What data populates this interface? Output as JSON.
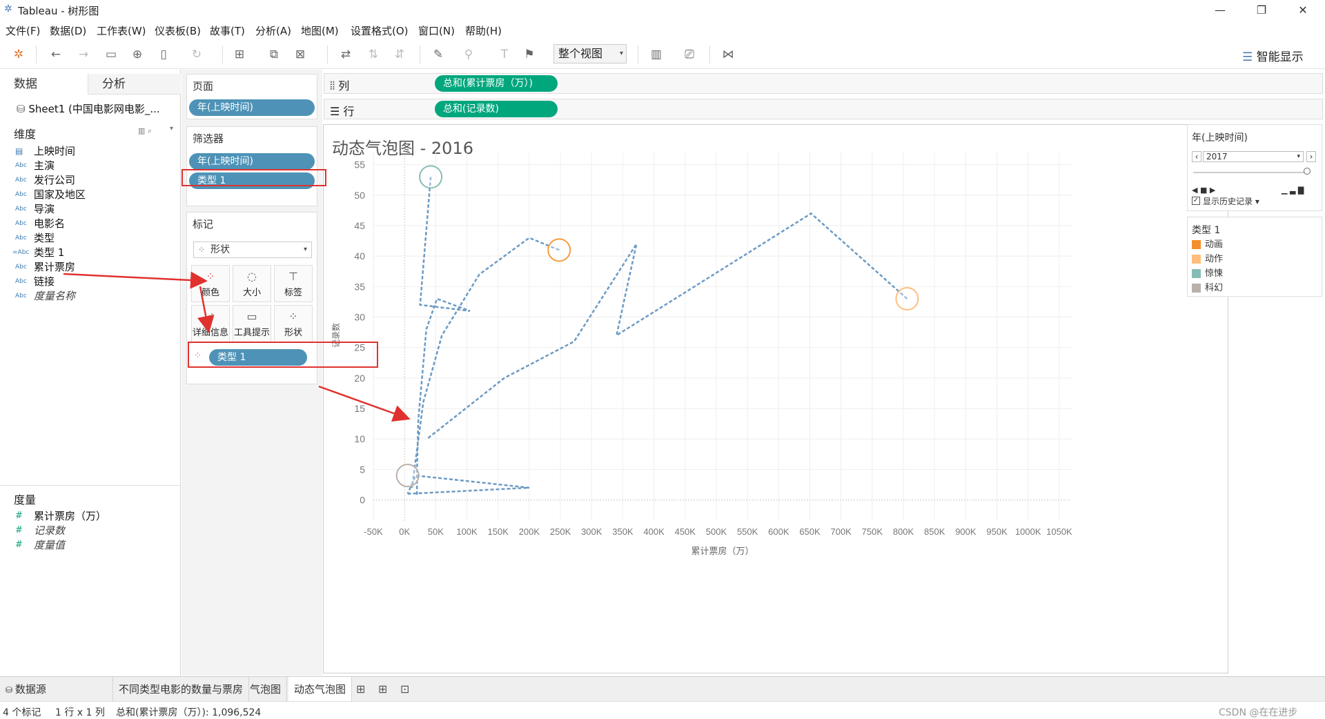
{
  "window": {
    "title": "Tableau - 树形图",
    "minimize": "—",
    "restore": "❐",
    "close": "✕"
  },
  "menu": [
    "文件(F)",
    "数据(D)",
    "工作表(W)",
    "仪表板(B)",
    "故事(T)",
    "分析(A)",
    "地图(M)",
    "设置格式(O)",
    "窗口(N)",
    "帮助(H)"
  ],
  "toolbar": {
    "view_mode": "整个视图",
    "smart_show": "智能显示"
  },
  "left": {
    "tab_data": "数据",
    "tab_analysis": "分析",
    "source": "Sheet1 (中国电影网电影_...",
    "dimensions_title": "维度",
    "dimensions": [
      {
        "icon": "date",
        "name": "上映时间"
      },
      {
        "icon": "Abc",
        "name": "主演"
      },
      {
        "icon": "Abc",
        "name": "发行公司"
      },
      {
        "icon": "Abc",
        "name": "国家及地区"
      },
      {
        "icon": "Abc",
        "name": "导演"
      },
      {
        "icon": "Abc",
        "name": "电影名"
      },
      {
        "icon": "Abc",
        "name": "类型"
      },
      {
        "icon": "=Abc",
        "name": "类型 1"
      },
      {
        "icon": "Abc",
        "name": "累计票房"
      },
      {
        "icon": "Abc",
        "name": "链接"
      },
      {
        "icon": "Abc",
        "name": "度量名称"
      }
    ],
    "measures_title": "度量",
    "measures": [
      {
        "name": "累计票房（万）"
      },
      {
        "name": "记录数"
      },
      {
        "name": "度量值"
      }
    ]
  },
  "shelves": {
    "pages_title": "页面",
    "pages_pill": "年(上映时间)",
    "filters_title": "筛选器",
    "filter_pills": [
      "年(上映时间)",
      "类型 1"
    ],
    "marks_title": "标记",
    "mark_type": "形状",
    "mark_buttons": [
      "颜色",
      "大小",
      "标签",
      "详细信息",
      "工具提示",
      "形状"
    ],
    "mark_pill": "类型 1",
    "columns_label": "列",
    "columns_pill": "总和(累计票房（万）)",
    "rows_label": "行",
    "rows_pill": "总和(记录数)"
  },
  "chart_data": {
    "type": "scatter",
    "title": "动态气泡图 - 2016",
    "xlabel": "累计票房（万）",
    "ylabel": "记录数",
    "xlim": [
      -50000,
      1070000
    ],
    "ylim": [
      -3,
      57
    ],
    "x_ticks": [
      "-50K",
      "0K",
      "50K",
      "100K",
      "150K",
      "200K",
      "250K",
      "300K",
      "350K",
      "400K",
      "450K",
      "500K",
      "550K",
      "600K",
      "650K",
      "700K",
      "750K",
      "800K",
      "850K",
      "900K",
      "950K",
      "1000K",
      "1050K"
    ],
    "y_ticks": [
      "0",
      "5",
      "10",
      "15",
      "20",
      "25",
      "30",
      "35",
      "40",
      "45",
      "50",
      "55"
    ],
    "grid": true,
    "history_trails": [
      [
        [
          42000,
          53
        ],
        [
          25000,
          32
        ],
        [
          105000,
          31
        ],
        [
          52000,
          33
        ],
        [
          35000,
          28
        ],
        [
          22000,
          13
        ],
        [
          20000,
          4.5
        ],
        [
          20000,
          0.8
        ]
      ],
      [
        [
          248000,
          41
        ],
        [
          200000,
          43
        ],
        [
          120000,
          37
        ],
        [
          60000,
          27
        ],
        [
          30000,
          16
        ],
        [
          12000,
          2
        ]
      ],
      [
        [
          806000,
          33
        ],
        [
          652000,
          47
        ],
        [
          340000,
          27
        ],
        [
          372000,
          42
        ],
        [
          272000,
          26
        ],
        [
          160000,
          20
        ],
        [
          36000,
          10
        ]
      ],
      [
        [
          5000,
          1
        ],
        [
          200000,
          2
        ],
        [
          18000,
          4
        ],
        [
          5000,
          1
        ]
      ]
    ],
    "bubbles": [
      {
        "category": "惊悚",
        "x": 42000,
        "y": 53,
        "color": "#86bcb6"
      },
      {
        "category": "动作",
        "x": 248000,
        "y": 41,
        "color": "#f59c3c"
      },
      {
        "category": "动作",
        "x": 806000,
        "y": 33,
        "color": "#ffbe7d"
      },
      {
        "category": "科幻",
        "x": 5000,
        "y": 4,
        "color": "#bab0ac"
      }
    ]
  },
  "right": {
    "page_title": "年(上映时间)",
    "page_value": "2017",
    "show_history": "显示历史记录",
    "legend_title": "类型 1",
    "legend": [
      {
        "label": "动画",
        "color": "#f28e2b"
      },
      {
        "label": "动作",
        "color": "#ffbe7d"
      },
      {
        "label": "惊悚",
        "color": "#86bcb6"
      },
      {
        "label": "科幻",
        "color": "#bab0ac"
      }
    ]
  },
  "tabs": [
    "数据源",
    "不同类型电影的数量与票房",
    "气泡图",
    "动态气泡图"
  ],
  "status": {
    "marks": "4 个标记",
    "rowscols": "1 行 x 1 列",
    "sum": "总和(累计票房（万）): 1,096,524",
    "watermark": "CSDN @在在进步"
  }
}
